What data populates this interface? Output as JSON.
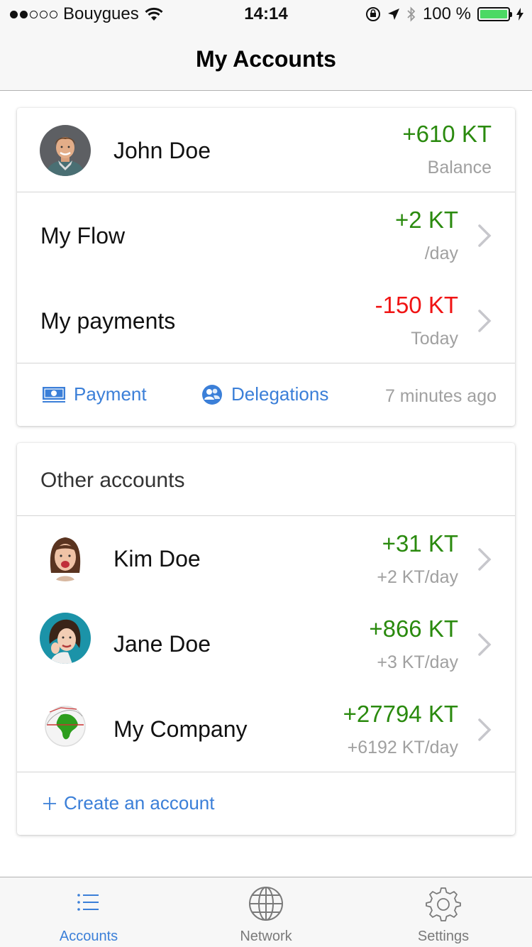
{
  "status_bar": {
    "carrier": "Bouygues",
    "time": "14:14",
    "battery": "100 %",
    "battery_level": 1.0,
    "signal_bars": 2
  },
  "header": {
    "title": "My Accounts"
  },
  "main_account": {
    "name": "John Doe",
    "balance": "+610 KT",
    "balance_label": "Balance",
    "flow": {
      "label": "My Flow",
      "amount": "+2 KT",
      "sub": "/day"
    },
    "payments": {
      "label": "My payments",
      "amount": "-150 KT",
      "sub": "Today"
    },
    "actions": {
      "payment": "Payment",
      "delegations": "Delegations",
      "updated": "7 minutes ago"
    }
  },
  "other_accounts": {
    "title": "Other accounts",
    "items": [
      {
        "name": "Kim Doe",
        "amount": "+31 KT",
        "rate": "+2 KT/day"
      },
      {
        "name": "Jane Doe",
        "amount": "+866 KT",
        "rate": "+3 KT/day"
      },
      {
        "name": "My Company",
        "amount": "+27794 KT",
        "rate": "+6192 KT/day"
      }
    ],
    "create": "Create an account"
  },
  "tabs": [
    {
      "label": "Accounts",
      "icon": "list-icon",
      "active": true
    },
    {
      "label": "Network",
      "icon": "globe-icon",
      "active": false
    },
    {
      "label": "Settings",
      "icon": "gear-icon",
      "active": false
    }
  ],
  "colors": {
    "positive": "#2a8a0e",
    "negative": "#f01414",
    "accent": "#3b7fd8",
    "battery": "#4cd964"
  }
}
